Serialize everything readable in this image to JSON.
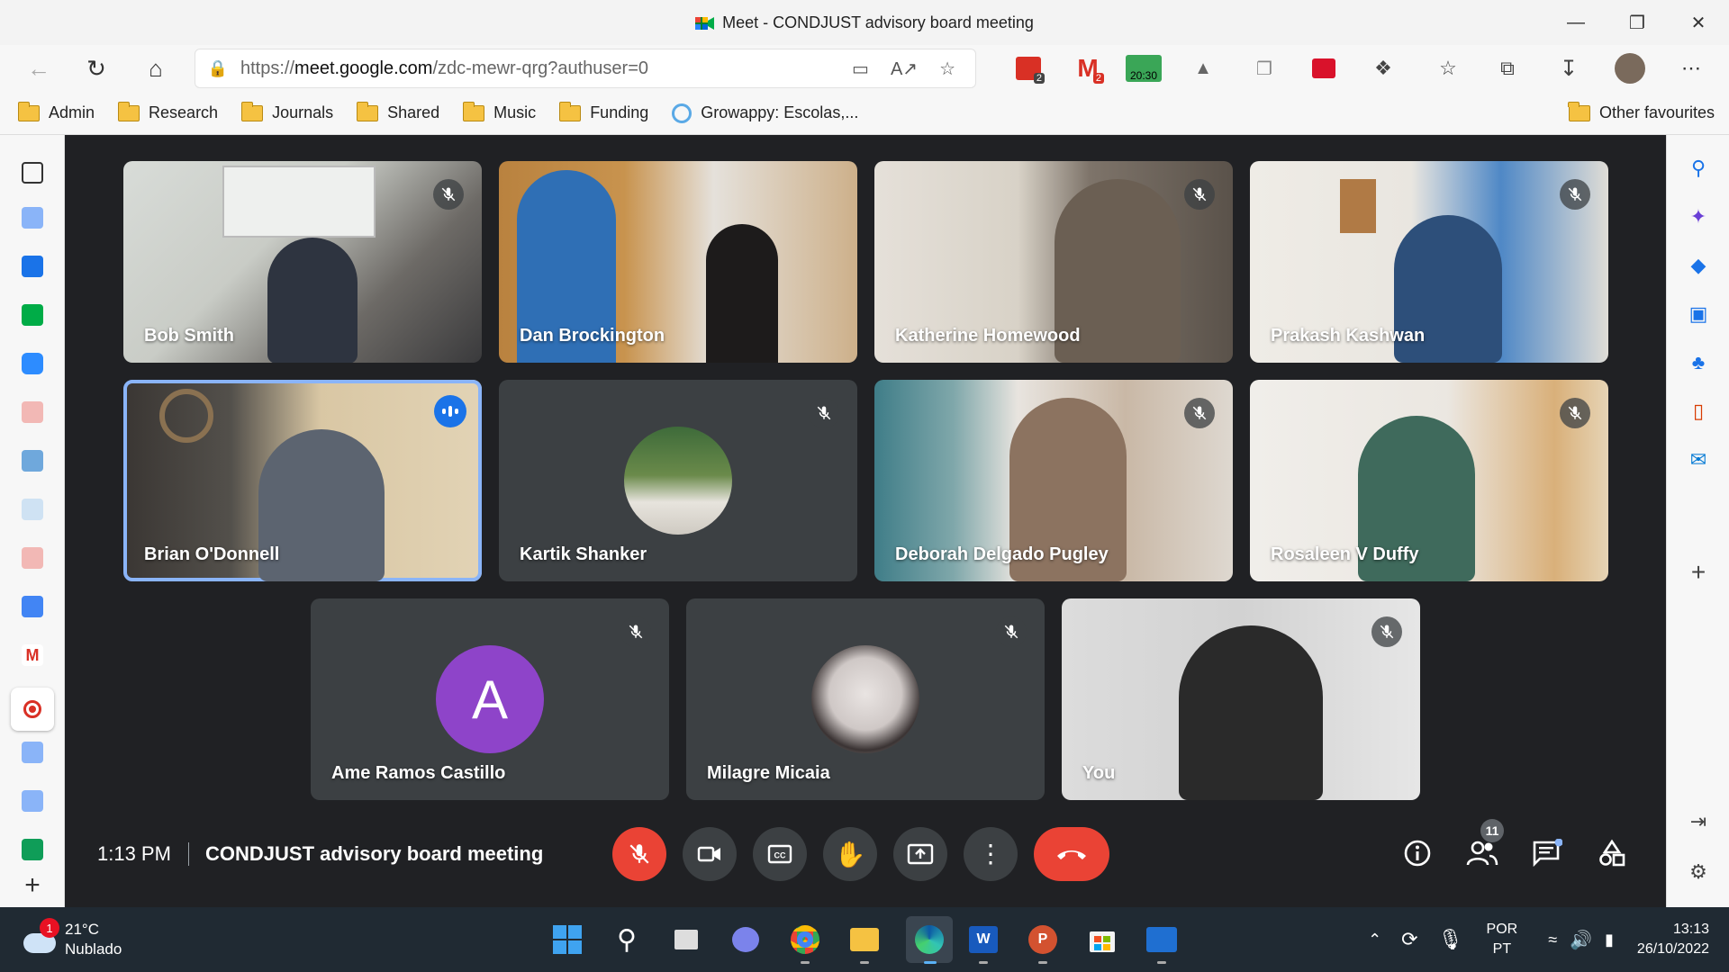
{
  "window": {
    "title": "Meet - CONDJUST advisory board meeting"
  },
  "browser": {
    "url_prefix": "https://",
    "url_host": "meet.google.com",
    "url_path": "/zdc-mewr-qrg?authuser=0",
    "ext_badges": {
      "calendar": "2",
      "gmail": "2",
      "clock": "20:30"
    }
  },
  "favourites": {
    "items": [
      {
        "label": "Admin"
      },
      {
        "label": "Research"
      },
      {
        "label": "Journals"
      },
      {
        "label": "Shared"
      },
      {
        "label": "Music"
      },
      {
        "label": "Funding"
      },
      {
        "label": "Growappy: Escolas,..."
      }
    ],
    "other": "Other favourites"
  },
  "participants": [
    {
      "name": "Bob Smith",
      "muted": true
    },
    {
      "name": "Dan Brockington",
      "muted": false
    },
    {
      "name": "Katherine Homewood",
      "muted": true
    },
    {
      "name": "Prakash Kashwan",
      "muted": true
    },
    {
      "name": "Brian O'Donnell",
      "speaking": true
    },
    {
      "name": "Kartik Shanker",
      "muted": true
    },
    {
      "name": "Deborah Delgado Pugley",
      "muted": true
    },
    {
      "name": "Rosaleen V Duffy",
      "muted": true
    },
    {
      "name": "Ame Ramos Castillo",
      "muted": true,
      "initial": "A"
    },
    {
      "name": "Milagre Micaia",
      "muted": true
    },
    {
      "name": "You",
      "muted": true
    }
  ],
  "meeting": {
    "time": "1:13 PM",
    "title": "CONDJUST advisory board meeting",
    "participant_count": "11"
  },
  "taskbar": {
    "weather_temp": "21°C",
    "weather_desc": "Nublado",
    "weather_badge": "1",
    "lang_1": "POR",
    "lang_2": "PT",
    "time": "13:13",
    "date": "26/10/2022"
  },
  "colors": {
    "meet_bg": "#202124",
    "tile_bg": "#3c4043",
    "mic_off_red": "#ea4335",
    "speaking_blue": "#1a73e8"
  }
}
